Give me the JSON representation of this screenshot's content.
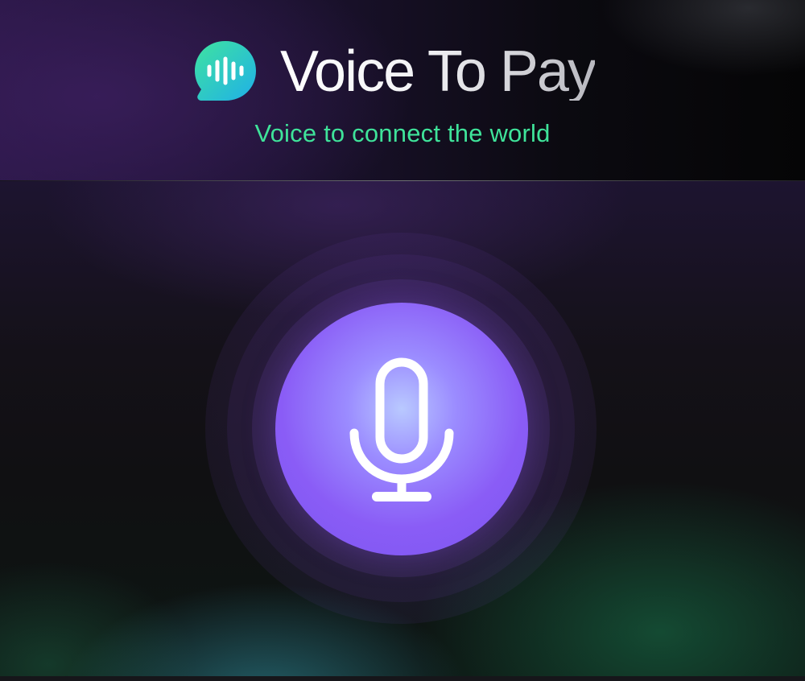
{
  "app": {
    "title": "Voice To Pay",
    "tagline": "Voice to connect the world"
  },
  "icons": {
    "logo": "voice-chat-bubble-icon",
    "mic": "microphone-icon"
  },
  "colors": {
    "tagline": "#3fe39a",
    "logo_gradient_start": "#3fe3a0",
    "logo_gradient_end": "#1fb0e8",
    "mic_button": "#8a5cf6",
    "mic_highlight": "#b9c9ff"
  }
}
